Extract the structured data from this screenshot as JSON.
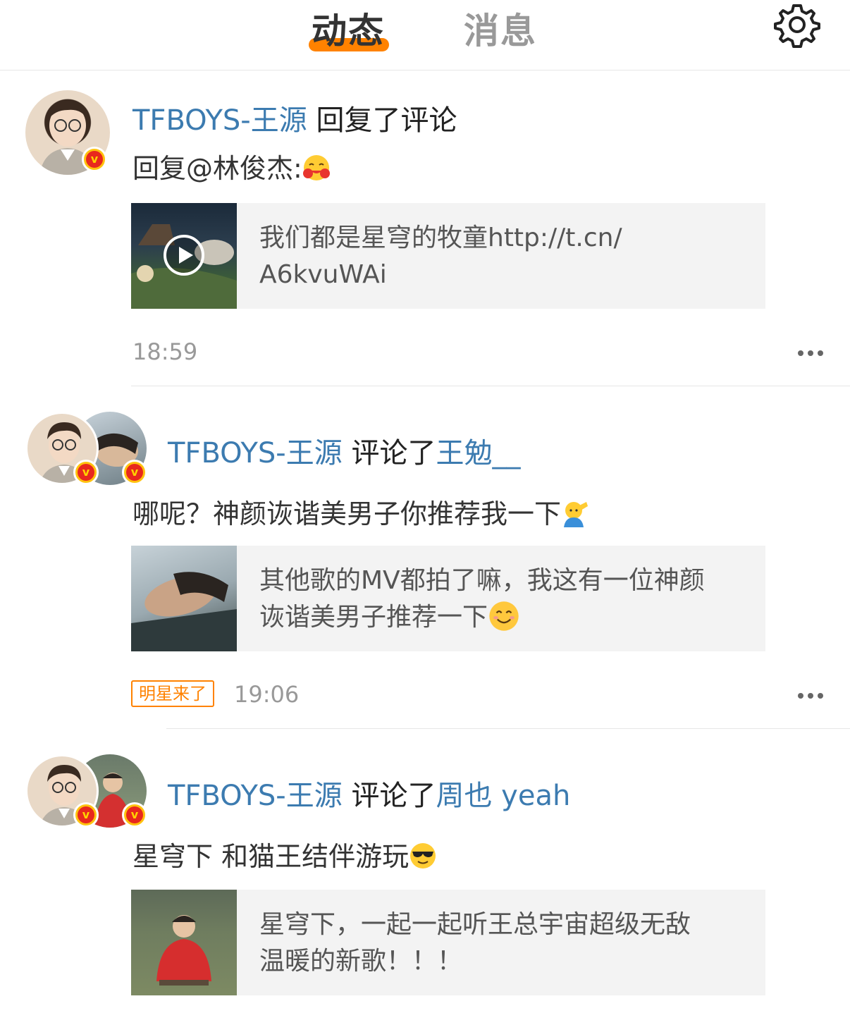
{
  "header": {
    "tab_active": "动态",
    "tab_inactive": "消息",
    "settings_icon": "gear-icon",
    "accent": "#ff8200"
  },
  "feed": [
    {
      "user": "TFBOYS-王源",
      "action": "回复了评论",
      "body": "回复@林俊杰:",
      "emoji": "hug-emoji",
      "card_text_line1": "我们都是星穹的牧童http://t.cn/",
      "card_text_line2": "A6kvuWAi",
      "card_has_play": true,
      "time": "18:59"
    },
    {
      "user": "TFBOYS-王源",
      "action": "评论了",
      "target": "王勉__",
      "body": "哪呢？神颜诙谐美男子你推荐我一下",
      "emoji": "salute-emoji",
      "card_text_line1": "其他歌的MV都拍了嘛，我这有一位神颜",
      "card_text_line2": "诙谐美男子推荐一下",
      "tag": "明星来了",
      "time": "19:06"
    },
    {
      "user": "TFBOYS-王源",
      "action": "评论了",
      "target": "周也 yeah",
      "body": "星穹下 和猫王结伴游玩",
      "emoji": "sunglasses-emoji",
      "card_text_line1": "星穹下，一起一起听王总宇宙超级无敌",
      "card_text_line2": "温暖的新歌！！！"
    }
  ],
  "colors": {
    "username": "#3c7bb0",
    "verified_badge": "#ffc20e",
    "time": "#999999"
  }
}
